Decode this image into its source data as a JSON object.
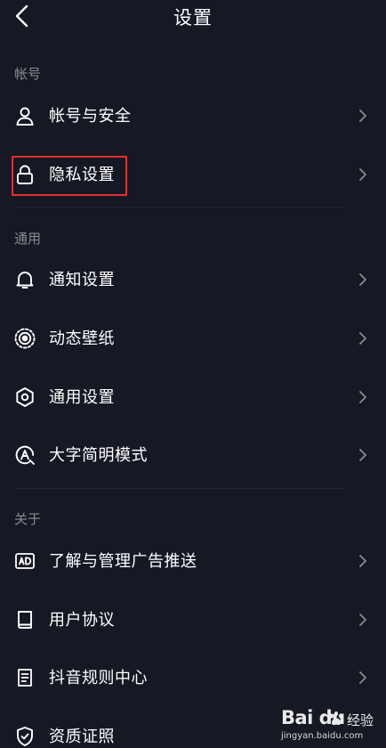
{
  "header": {
    "title": "设置",
    "back_icon": "chevron-left-icon"
  },
  "sections": [
    {
      "label": "帐号",
      "items": [
        {
          "label": "帐号与安全",
          "icon": "user-icon"
        },
        {
          "label": "隐私设置",
          "icon": "lock-icon",
          "highlighted": true
        }
      ]
    },
    {
      "label": "通用",
      "items": [
        {
          "label": "通知设置",
          "icon": "bell-icon"
        },
        {
          "label": "动态壁纸",
          "icon": "live-wallpaper-icon"
        },
        {
          "label": "通用设置",
          "icon": "gear-icon"
        },
        {
          "label": "大字简明模式",
          "icon": "large-font-icon"
        }
      ]
    },
    {
      "label": "关于",
      "items": [
        {
          "label": "了解与管理广告推送",
          "icon": "ad-icon"
        },
        {
          "label": "用户协议",
          "icon": "book-icon"
        },
        {
          "label": "抖音规则中心",
          "icon": "document-icon"
        },
        {
          "label": "资质证照",
          "icon": "shield-check-icon"
        }
      ]
    }
  ],
  "watermark": {
    "logo": "Bai du",
    "name": "经验",
    "url": "jingyan.baidu.com"
  },
  "colors": {
    "background": "#161823",
    "highlight": "#e0312f",
    "muted": "#8a8b91"
  }
}
